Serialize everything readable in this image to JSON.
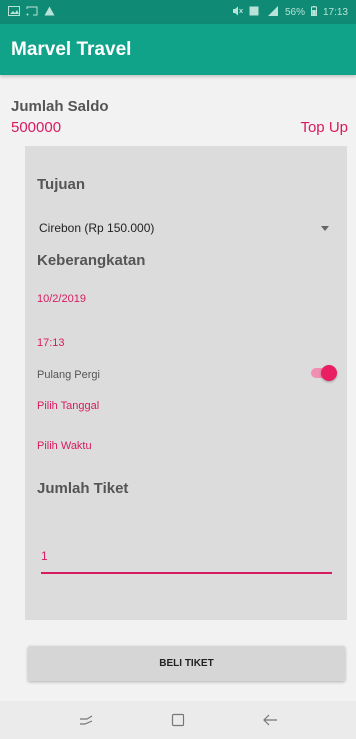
{
  "status_bar": {
    "battery": "56%",
    "time": "17:13"
  },
  "app_bar": {
    "title": "Marvel Travel"
  },
  "saldo": {
    "label": "Jumlah Saldo",
    "value": "500000",
    "topup_label": "Top Up"
  },
  "form": {
    "tujuan_title": "Tujuan",
    "tujuan_selected": "Cirebon (Rp 150.000)",
    "keberangkatan_title": "Keberangkatan",
    "date": "10/2/2019",
    "time": "17:13",
    "pulang_pergi_label": "Pulang Pergi",
    "pulang_pergi_on": true,
    "pilih_tanggal": "Pilih Tanggal",
    "pilih_waktu": "Pilih Waktu",
    "jumlah_tiket_title": "Jumlah Tiket",
    "jumlah_tiket_value": "1"
  },
  "beli_button": "BELI TIKET",
  "colors": {
    "status_bar": "#0f8a74",
    "app_bar": "#11a28a",
    "accent": "#d81b60",
    "card": "#dcdcdc"
  },
  "nav_icons": [
    "recent-apps-icon",
    "home-icon",
    "back-icon"
  ]
}
